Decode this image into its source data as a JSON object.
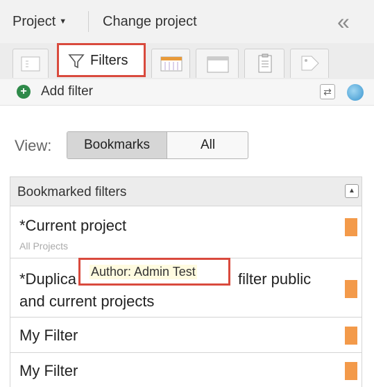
{
  "header": {
    "project_label": "Project",
    "change_project": "Change project",
    "collapse_glyph": "«"
  },
  "tabs": {
    "filters_label": "Filters"
  },
  "actions": {
    "add_filter": "Add filter"
  },
  "view": {
    "label": "View:",
    "options": [
      "Bookmarks",
      "All"
    ],
    "selected": "Bookmarks"
  },
  "panel": {
    "title": "Bookmarked filters",
    "rows": [
      {
        "name": "*Current project",
        "sub": "All Projects"
      },
      {
        "name_line1_start": "*Duplica",
        "name_line1_end": "filter public",
        "name_line2": "and current projects"
      },
      {
        "name": "My Filter"
      },
      {
        "name": "My Filter"
      }
    ]
  },
  "tooltip": {
    "text": "Author: Admin Test"
  },
  "colors": {
    "highlight_border": "#d94a3d",
    "bookmark": "#f39a4a",
    "add_icon": "#2f8a4a"
  }
}
